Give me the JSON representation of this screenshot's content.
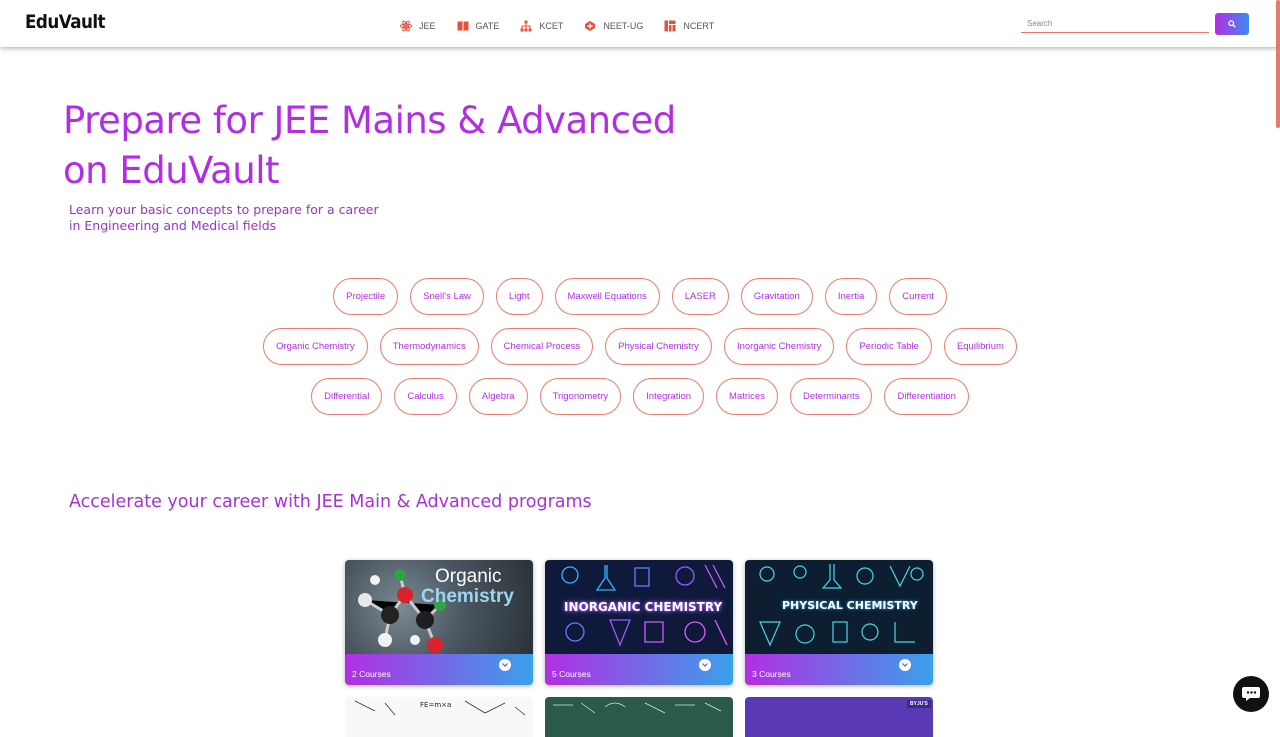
{
  "header": {
    "logo": "EduVault",
    "nav": [
      {
        "label": "JEE",
        "icon": "atom-icon",
        "color": "#e8503a"
      },
      {
        "label": "GATE",
        "icon": "book-icon",
        "color": "#e8503a"
      },
      {
        "label": "KCET",
        "icon": "sitemap-icon",
        "color": "#e8503a"
      },
      {
        "label": "NEET-UG",
        "icon": "medical-icon",
        "color": "#e8503a"
      },
      {
        "label": "NCERT",
        "icon": "grid-icon",
        "color": "#e8503a"
      }
    ],
    "search": {
      "placeholder": "Search",
      "value": ""
    }
  },
  "hero": {
    "title": "Prepare for JEE Mains & Advanced on EduVault",
    "subtitle": "Learn your basic concepts to prepare for a career in Engineering and Medical fields"
  },
  "topics": {
    "row1": [
      "Projectile",
      "Snell's Law",
      "Light",
      "Maxwell Equations",
      "LASER",
      "Gravitation",
      "Inertia",
      "Current"
    ],
    "row2": [
      "Organic Chemistry",
      "Thermodynamics",
      "Chemical Process",
      "Physical Chemistry",
      "Inorganic Chemistry",
      "Periodic Table",
      "Equilibrium"
    ],
    "row3": [
      "Differential",
      "Calculus",
      "Algebra",
      "Trigonometry",
      "Integration",
      "Matrices",
      "Determinants",
      "Differentiation"
    ]
  },
  "programs": {
    "title": "Accelerate your career with JEE Main & Advanced programs",
    "cards": [
      {
        "title_line1": "Organic",
        "title_line2": "Chemistry",
        "count": "2 Courses"
      },
      {
        "title_line1": "INORGANIC CHEMISTRY",
        "count": "5 Courses"
      },
      {
        "title_line1": "PHYSICAL CHEMISTRY",
        "count": "3 Courses"
      }
    ],
    "second_row_badge": "BYJU'S"
  },
  "colors": {
    "accent": "#b22ee3",
    "chip_border": "#e87d6d",
    "gradient_start": "#b22ee3",
    "gradient_end": "#3aa0ea"
  }
}
